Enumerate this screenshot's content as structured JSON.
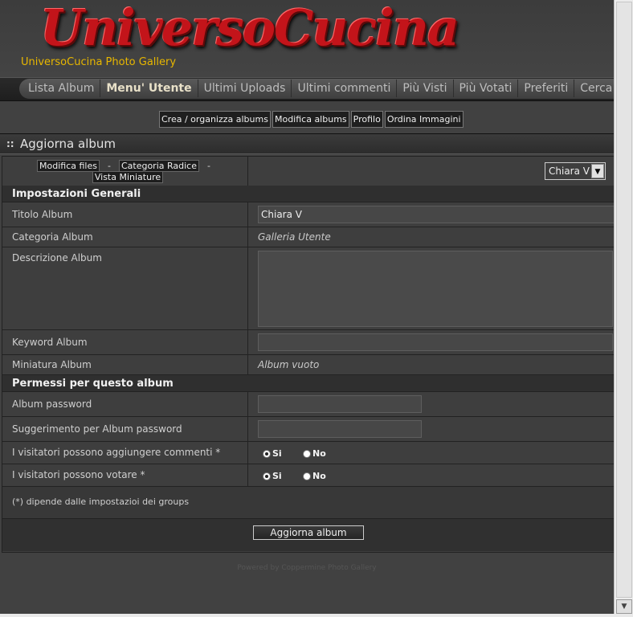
{
  "header": {
    "logo_text": "UniversoCucina",
    "subtitle": "UniversoCucina Photo Gallery"
  },
  "nav": {
    "items": [
      {
        "label": "Lista Album"
      },
      {
        "label": "Menu' Utente"
      },
      {
        "label": "Ultimi Uploads"
      },
      {
        "label": "Ultimi commenti"
      },
      {
        "label": "Più Visti"
      },
      {
        "label": "Più Votati"
      },
      {
        "label": "Preferiti"
      },
      {
        "label": "Cerca"
      }
    ],
    "active_index": 1
  },
  "subnav": {
    "items": [
      {
        "label": "Crea / organizza albums"
      },
      {
        "label": "Modifica albums"
      },
      {
        "label": "Profilo"
      },
      {
        "label": "Ordina Immagini"
      }
    ]
  },
  "section": {
    "title": "Aggiorna album"
  },
  "toolbar": {
    "link_modifica_files": "Modifica files",
    "link_categoria_radice": "Categoria Radice",
    "link_vista_miniature": "Vista Miniature",
    "separator": "-",
    "album_select_value": "Chiara V",
    "select_arrow": "▼"
  },
  "form": {
    "group_general": "Impostazioni Generali",
    "titolo_label": "Titolo Album",
    "titolo_value": "Chiara V",
    "categoria_label": "Categoria Album",
    "categoria_value": "Galleria Utente",
    "descrizione_label": "Descrizione Album",
    "descrizione_value": "",
    "keyword_label": "Keyword Album",
    "keyword_value": "",
    "miniatura_label": "Miniatura Album",
    "miniatura_value": "Album vuoto",
    "group_permessi": "Permessi per questo album",
    "password_label": "Album password",
    "password_value": "",
    "hint_label": "Suggerimento per Album password",
    "hint_value": "",
    "commenti_label": "I visitatori possono aggiungere commenti *",
    "votare_label": "I visitatori possono votare *",
    "yes_label": "Si",
    "no_label": "No",
    "commenti_selected": "Si",
    "votare_selected": "Si",
    "note": "(*) dipende dalle impostazioi dei groups",
    "submit_label": "Aggiorna album"
  },
  "footer": {
    "text": "Powered by Coppermine Photo Gallery"
  }
}
